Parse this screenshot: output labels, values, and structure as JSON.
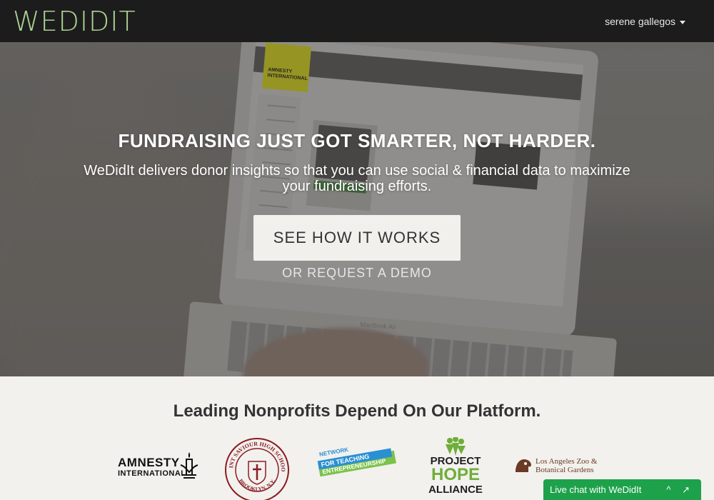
{
  "nav": {
    "brand": "WEDIDIT",
    "user": "serene gallegos"
  },
  "hero": {
    "title": "FUNDRAISING JUST GOT SMARTER, NOT HARDER.",
    "subtitle": "WeDidIt delivers donor insights so that you can use social & financial data to maximize your fundraising efforts.",
    "cta": "SEE HOW IT WORKS",
    "secondary": "OR REQUEST A DEMO",
    "screen_logo": "AMNESTY INTERNATIONAL",
    "device_label": "MacBook Air"
  },
  "partners": {
    "title": "Leading Nonprofits Depend On Our Platform.",
    "amnesty": [
      "AMNESTY",
      "INTERNATIONAL"
    ],
    "ssh_ring": "SAINT SAVIOUR HIGH SCHOOL",
    "ssh_bottom": "BROOKLYN, N.Y.",
    "nfte": [
      "NETWORK",
      "FOR TEACHING",
      "ENTREPRENEURSHIP"
    ],
    "pha": [
      "PROJECT",
      "HOPE",
      "ALLIANCE"
    ],
    "laz": [
      "Los Angeles Zoo &",
      "Botanical Gardens"
    ]
  },
  "livechat": {
    "label": "Live chat with WeDidIt",
    "icons": "^ ↗"
  },
  "colors": {
    "brand_green": "#a9d494",
    "nav_bg": "#1d1c1c",
    "chat_green": "#1ea14b"
  }
}
